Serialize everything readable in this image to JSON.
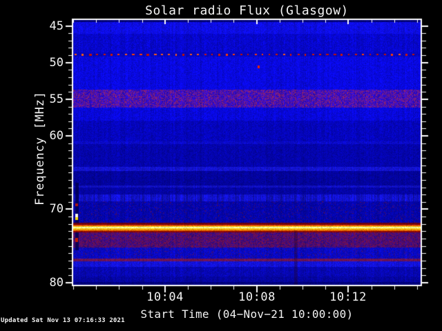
{
  "footer": {
    "updated_text": "Updated Sat Nov 13 07:16:33 2021"
  },
  "chart_data": {
    "type": "heatmap",
    "title": "Solar radio Flux (Glasgow)",
    "xlabel": "Start Time (04−Nov−21 10:00:00)",
    "ylabel": "Frequency [MHz]",
    "x_start_time": "10:00:00",
    "x_range_minutes": [
      0,
      15.15
    ],
    "x_major_ticks": [
      {
        "minutes": 4,
        "label": "10:04"
      },
      {
        "minutes": 8,
        "label": "10:08"
      },
      {
        "minutes": 12,
        "label": "10:12"
      }
    ],
    "x_minor_step_minutes": 1,
    "y_range_mhz": [
      44.2,
      80.3
    ],
    "y_major_ticks": [
      {
        "mhz": 45,
        "label": "45"
      },
      {
        "mhz": 50,
        "label": "50"
      },
      {
        "mhz": 55,
        "label": "55"
      },
      {
        "mhz": 60,
        "label": "60"
      },
      {
        "mhz": 70,
        "label": "70"
      },
      {
        "mhz": 80,
        "label": "80"
      }
    ],
    "y_minor_step_mhz": 1,
    "axis_color": "#ffffff",
    "background_color": "#000000",
    "bands": [
      {
        "f0": 44.2,
        "f1": 44.5,
        "color": "#000078",
        "cn": 0.2
      },
      {
        "f0": 44.5,
        "f1": 46.1,
        "color": "#0d0de6",
        "cn": 0.3
      },
      {
        "f0": 46.1,
        "f1": 48.65,
        "color": "#0707cd",
        "cn": 0.3
      },
      {
        "f0": 48.65,
        "f1": 49.15,
        "color": "#0505c2",
        "cn": 0.2
      },
      {
        "f0": 49.15,
        "f1": 53.7,
        "color": "#0909e0",
        "cn": 0.3
      },
      {
        "f0": 53.7,
        "f1": 56.1,
        "color": "#2d0bc8",
        "cn": 0.35,
        "sp": "#aa2858",
        "p": 0.38,
        "name": "55MHz-purple-band"
      },
      {
        "f0": 56.1,
        "f1": 57.95,
        "color": "#0808da",
        "cn": 0.3
      },
      {
        "f0": 57.95,
        "f1": 60.7,
        "color": "#0505bc",
        "cn": 0.25
      },
      {
        "f0": 60.7,
        "f1": 61.1,
        "color": "#0a0ac8",
        "cn": 0.25
      },
      {
        "f0": 61.1,
        "f1": 64.2,
        "color": "#0404ac",
        "cn": 0.25
      },
      {
        "f0": 64.2,
        "f1": 64.8,
        "color": "#1313d0",
        "cn": 0.3
      },
      {
        "f0": 64.8,
        "f1": 66.75,
        "color": "#03039c",
        "cn": 0.25
      },
      {
        "f0": 66.75,
        "f1": 67.05,
        "color": "#1010c2",
        "cn": 0.3
      },
      {
        "f0": 67.05,
        "f1": 68.0,
        "color": "#0404a4",
        "cn": 0.25
      },
      {
        "f0": 68.0,
        "f1": 68.9,
        "color": "#1111ca",
        "cn": 0.9,
        "name": "striped-band"
      },
      {
        "f0": 68.9,
        "f1": 71.85,
        "color": "#0505aa",
        "cn": 0.3,
        "sp": "#70123c",
        "p": 0.05
      },
      {
        "f0": 71.85,
        "f1": 72.12,
        "color": "#6e0010",
        "cn": 0.15
      },
      {
        "f0": 72.12,
        "f1": 72.3,
        "color": "#e05200",
        "cn": 0.1
      },
      {
        "f0": 72.3,
        "f1": 72.42,
        "color": "#ffd818",
        "cn": 0.05,
        "name": "carrier-line-72.5MHz"
      },
      {
        "f0": 72.42,
        "f1": 72.62,
        "color": "#ffffa2",
        "cn": 0.05
      },
      {
        "f0": 72.62,
        "f1": 72.78,
        "color": "#ffc814",
        "cn": 0.05
      },
      {
        "f0": 72.78,
        "f1": 72.95,
        "color": "#e06a00",
        "cn": 0.1
      },
      {
        "f0": 72.95,
        "f1": 73.2,
        "color": "#8a0404",
        "cn": 0.15
      },
      {
        "f0": 73.2,
        "f1": 75.25,
        "color": "#360a84",
        "cn": 0.3,
        "sp": "#8c1238",
        "p": 0.42,
        "name": "post-carrier-band"
      },
      {
        "f0": 75.25,
        "f1": 76.7,
        "color": "#0909c2",
        "cn": 0.3,
        "sp": "#6a1240",
        "p": 0.07
      },
      {
        "f0": 76.7,
        "f1": 77.1,
        "color": "#6a1458",
        "cn": 0.2,
        "name": "76.9MHz-line"
      },
      {
        "f0": 77.1,
        "f1": 77.9,
        "color": "#1212da",
        "cn": 0.35
      },
      {
        "f0": 77.9,
        "f1": 79.15,
        "color": "#0707b2",
        "cn": 0.3
      },
      {
        "f0": 79.15,
        "f1": 79.95,
        "color": "#0505a2",
        "cn": 0.25
      },
      {
        "f0": 79.95,
        "f1": 80.3,
        "color": "#00007e",
        "cn": 0.2
      }
    ],
    "dotted_line": {
      "mhz": 48.93,
      "t0": 0.1,
      "t1": 15.1,
      "spacing_minutes": 0.3133,
      "colors": [
        "#d41800",
        "#ff3c00",
        "#ff5a12",
        "#c41200"
      ],
      "name": "49MHz-red-dotted-interference"
    },
    "point_event": {
      "minutes": 8.08,
      "mhz": 50.6,
      "color": "#e82400"
    },
    "left_edge_column": {
      "t0": 0.09,
      "t1": 0.24,
      "f0": 66.4,
      "f1": 75.6,
      "color": "#000052",
      "skip_f0": 71.85,
      "skip_f1": 73.2,
      "blobs": [
        {
          "f0": 69.2,
          "f1": 69.55,
          "color": "#a81414"
        },
        {
          "f0": 70.6,
          "f1": 71.1,
          "color": "#f6f6ee"
        },
        {
          "f0": 71.1,
          "f1": 71.5,
          "color": "#ffdf00"
        },
        {
          "f0": 73.95,
          "f1": 74.5,
          "color": "#c41a04"
        }
      ]
    },
    "vertical_streak": {
      "minutes": 9.7,
      "width_minutes": 0.15,
      "f0": 72.9,
      "f1": 80.3
    }
  }
}
